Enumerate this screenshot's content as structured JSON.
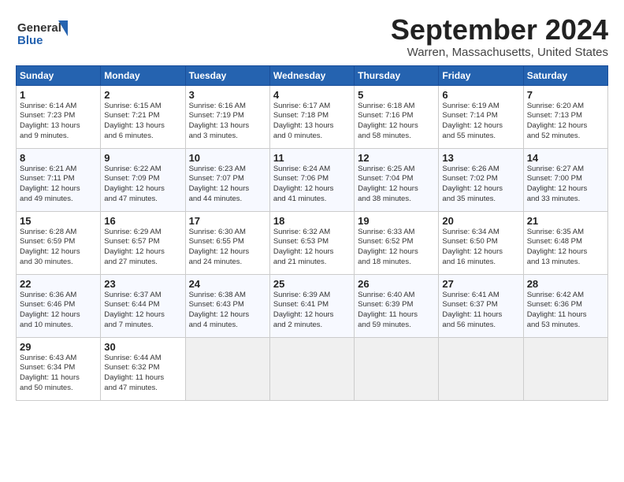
{
  "header": {
    "logo_line1": "General",
    "logo_line2": "Blue",
    "month": "September 2024",
    "location": "Warren, Massachusetts, United States"
  },
  "days_of_week": [
    "Sunday",
    "Monday",
    "Tuesday",
    "Wednesday",
    "Thursday",
    "Friday",
    "Saturday"
  ],
  "weeks": [
    [
      {
        "day": 1,
        "lines": [
          "Sunrise: 6:14 AM",
          "Sunset: 7:23 PM",
          "Daylight: 13 hours",
          "and 9 minutes."
        ]
      },
      {
        "day": 2,
        "lines": [
          "Sunrise: 6:15 AM",
          "Sunset: 7:21 PM",
          "Daylight: 13 hours",
          "and 6 minutes."
        ]
      },
      {
        "day": 3,
        "lines": [
          "Sunrise: 6:16 AM",
          "Sunset: 7:19 PM",
          "Daylight: 13 hours",
          "and 3 minutes."
        ]
      },
      {
        "day": 4,
        "lines": [
          "Sunrise: 6:17 AM",
          "Sunset: 7:18 PM",
          "Daylight: 13 hours",
          "and 0 minutes."
        ]
      },
      {
        "day": 5,
        "lines": [
          "Sunrise: 6:18 AM",
          "Sunset: 7:16 PM",
          "Daylight: 12 hours",
          "and 58 minutes."
        ]
      },
      {
        "day": 6,
        "lines": [
          "Sunrise: 6:19 AM",
          "Sunset: 7:14 PM",
          "Daylight: 12 hours",
          "and 55 minutes."
        ]
      },
      {
        "day": 7,
        "lines": [
          "Sunrise: 6:20 AM",
          "Sunset: 7:13 PM",
          "Daylight: 12 hours",
          "and 52 minutes."
        ]
      }
    ],
    [
      {
        "day": 8,
        "lines": [
          "Sunrise: 6:21 AM",
          "Sunset: 7:11 PM",
          "Daylight: 12 hours",
          "and 49 minutes."
        ]
      },
      {
        "day": 9,
        "lines": [
          "Sunrise: 6:22 AM",
          "Sunset: 7:09 PM",
          "Daylight: 12 hours",
          "and 47 minutes."
        ]
      },
      {
        "day": 10,
        "lines": [
          "Sunrise: 6:23 AM",
          "Sunset: 7:07 PM",
          "Daylight: 12 hours",
          "and 44 minutes."
        ]
      },
      {
        "day": 11,
        "lines": [
          "Sunrise: 6:24 AM",
          "Sunset: 7:06 PM",
          "Daylight: 12 hours",
          "and 41 minutes."
        ]
      },
      {
        "day": 12,
        "lines": [
          "Sunrise: 6:25 AM",
          "Sunset: 7:04 PM",
          "Daylight: 12 hours",
          "and 38 minutes."
        ]
      },
      {
        "day": 13,
        "lines": [
          "Sunrise: 6:26 AM",
          "Sunset: 7:02 PM",
          "Daylight: 12 hours",
          "and 35 minutes."
        ]
      },
      {
        "day": 14,
        "lines": [
          "Sunrise: 6:27 AM",
          "Sunset: 7:00 PM",
          "Daylight: 12 hours",
          "and 33 minutes."
        ]
      }
    ],
    [
      {
        "day": 15,
        "lines": [
          "Sunrise: 6:28 AM",
          "Sunset: 6:59 PM",
          "Daylight: 12 hours",
          "and 30 minutes."
        ]
      },
      {
        "day": 16,
        "lines": [
          "Sunrise: 6:29 AM",
          "Sunset: 6:57 PM",
          "Daylight: 12 hours",
          "and 27 minutes."
        ]
      },
      {
        "day": 17,
        "lines": [
          "Sunrise: 6:30 AM",
          "Sunset: 6:55 PM",
          "Daylight: 12 hours",
          "and 24 minutes."
        ]
      },
      {
        "day": 18,
        "lines": [
          "Sunrise: 6:32 AM",
          "Sunset: 6:53 PM",
          "Daylight: 12 hours",
          "and 21 minutes."
        ]
      },
      {
        "day": 19,
        "lines": [
          "Sunrise: 6:33 AM",
          "Sunset: 6:52 PM",
          "Daylight: 12 hours",
          "and 18 minutes."
        ]
      },
      {
        "day": 20,
        "lines": [
          "Sunrise: 6:34 AM",
          "Sunset: 6:50 PM",
          "Daylight: 12 hours",
          "and 16 minutes."
        ]
      },
      {
        "day": 21,
        "lines": [
          "Sunrise: 6:35 AM",
          "Sunset: 6:48 PM",
          "Daylight: 12 hours",
          "and 13 minutes."
        ]
      }
    ],
    [
      {
        "day": 22,
        "lines": [
          "Sunrise: 6:36 AM",
          "Sunset: 6:46 PM",
          "Daylight: 12 hours",
          "and 10 minutes."
        ]
      },
      {
        "day": 23,
        "lines": [
          "Sunrise: 6:37 AM",
          "Sunset: 6:44 PM",
          "Daylight: 12 hours",
          "and 7 minutes."
        ]
      },
      {
        "day": 24,
        "lines": [
          "Sunrise: 6:38 AM",
          "Sunset: 6:43 PM",
          "Daylight: 12 hours",
          "and 4 minutes."
        ]
      },
      {
        "day": 25,
        "lines": [
          "Sunrise: 6:39 AM",
          "Sunset: 6:41 PM",
          "Daylight: 12 hours",
          "and 2 minutes."
        ]
      },
      {
        "day": 26,
        "lines": [
          "Sunrise: 6:40 AM",
          "Sunset: 6:39 PM",
          "Daylight: 11 hours",
          "and 59 minutes."
        ]
      },
      {
        "day": 27,
        "lines": [
          "Sunrise: 6:41 AM",
          "Sunset: 6:37 PM",
          "Daylight: 11 hours",
          "and 56 minutes."
        ]
      },
      {
        "day": 28,
        "lines": [
          "Sunrise: 6:42 AM",
          "Sunset: 6:36 PM",
          "Daylight: 11 hours",
          "and 53 minutes."
        ]
      }
    ],
    [
      {
        "day": 29,
        "lines": [
          "Sunrise: 6:43 AM",
          "Sunset: 6:34 PM",
          "Daylight: 11 hours",
          "and 50 minutes."
        ]
      },
      {
        "day": 30,
        "lines": [
          "Sunrise: 6:44 AM",
          "Sunset: 6:32 PM",
          "Daylight: 11 hours",
          "and 47 minutes."
        ]
      },
      null,
      null,
      null,
      null,
      null
    ]
  ]
}
